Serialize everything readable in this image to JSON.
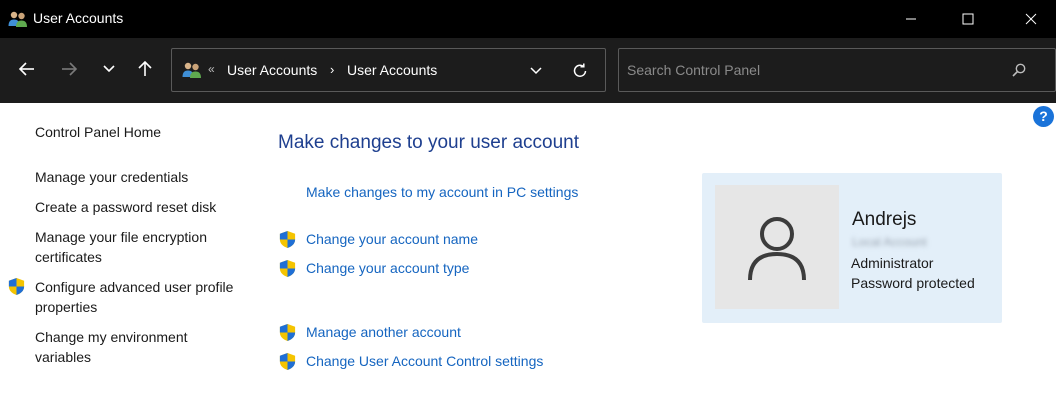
{
  "window": {
    "title": "User Accounts",
    "minimize_icon": "minimize-icon",
    "maximize_icon": "maximize-icon",
    "close_icon": "close-icon"
  },
  "nav": {
    "back_icon": "back-arrow-icon",
    "forward_icon": "forward-arrow-icon",
    "recent_icon": "chevron-down-icon",
    "up_icon": "up-arrow-icon"
  },
  "address": {
    "overflow": "«",
    "crumbs": [
      "User Accounts",
      "User Accounts"
    ],
    "separator": "›"
  },
  "search": {
    "placeholder": "Search Control Panel",
    "value": ""
  },
  "help": "?",
  "left_pane": {
    "home": "Control Panel Home",
    "links": [
      {
        "label": "Manage your credentials",
        "shield": false
      },
      {
        "label": "Create a password reset disk",
        "shield": false
      },
      {
        "label": "Manage your file encryption certificates",
        "shield": false
      },
      {
        "label": "Configure advanced user profile properties",
        "shield": true
      },
      {
        "label": "Change my environment variables",
        "shield": false
      }
    ]
  },
  "main": {
    "title": "Make changes to your user account",
    "links": [
      {
        "label": "Make changes to my account in PC settings",
        "shield": false
      },
      {
        "label": "Change your account name",
        "shield": true
      },
      {
        "label": "Change your account type",
        "shield": true
      },
      {
        "label": "Manage another account",
        "shield": true
      },
      {
        "label": "Change User Account Control settings",
        "shield": true
      }
    ]
  },
  "account": {
    "name": "Andrejs",
    "email": "Local Account",
    "type": "Administrator",
    "status": "Password protected"
  },
  "colors": {
    "titlebar": "#000000",
    "navbar": "#1c1c1c",
    "link": "#1565c0",
    "heading": "#1e3f8f",
    "card": "#e3eff9",
    "shield_blue": "#1f6fd6",
    "shield_yellow": "#f5c400"
  }
}
